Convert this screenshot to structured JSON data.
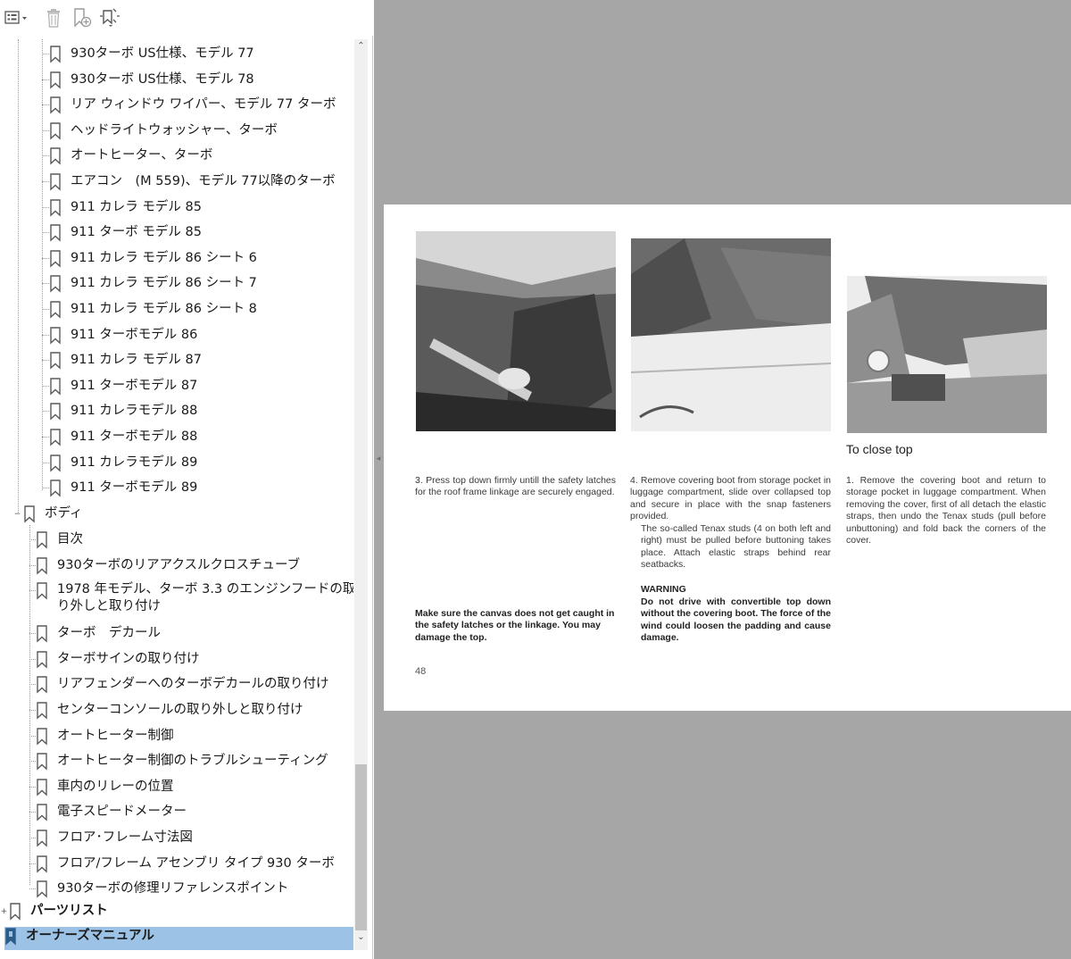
{
  "toolbar": {
    "options_icon": "options-menu-icon",
    "delete_icon": "trash-icon",
    "new_bookmark_icon": "new-bookmark-icon",
    "expand_icon": "expand-bookmark-icon"
  },
  "bookmarks": {
    "turbo_children": [
      "930ターボ US仕様、モデル 77",
      "930ターボ US仕様、モデル 78",
      "リア ウィンドウ ワイパー、モデル 77 ターボ",
      "ヘッドライトウォッシャー、ターボ",
      "オートヒーター、ターボ",
      "エアコン　(M 559)、モデル 77以降のターボ",
      "911 カレラ モデル 85",
      "911 ターボ モデル 85",
      "911 カレラ モデル 86 シート 6",
      "911 カレラ モデル 86 シート 7",
      "911 カレラ モデル 86 シート 8",
      "911 ターボモデル 86",
      "911 カレラ モデル 87",
      "911 ターボモデル 87",
      "911 カレラモデル 88",
      "911 ターボモデル 88",
      "911 カレラモデル 89",
      "911 ターボモデル 89"
    ],
    "body_label": "ボディ",
    "body_children": [
      "目次",
      "930ターボのリアアクスルクロスチューブ",
      "1978 年モデル、ターボ 3.3 のエンジンフードの取り外しと取り付け",
      "ターボ　デカール",
      "ターボサインの取り付け",
      "リアフェンダーへのターボデカールの取り付け",
      "センターコンソールの取り外しと取り付け",
      "オートヒーター制御",
      "オートヒーター制御のトラブルシューティング",
      "車内のリレーの位置",
      "電子スピードメーター",
      "フロア･フレーム寸法図",
      "フロア/フレーム アセンブリ タイプ 930 ターボ",
      "930ターボの修理リファレンスポイント"
    ],
    "parts_label": "パーツリスト",
    "owners_label": "オーナーズマニュアル",
    "expand_symbol": "+",
    "collapse_symbol": "−"
  },
  "document": {
    "section_heading": "To close top",
    "col1_step": "3. Press top down firmly untill the safety latches for the roof frame linkage are securely engaged.",
    "col1_note": "Make sure the canvas does not get caught in the safety latches or the linkage. You may damage the top.",
    "col2_step": "4. Remove covering boot from storage pocket in luggage compartment, slide over collapsed top and secure in place with the snap fasteners provided.",
    "col2_step_cont": "The so-called Tenax studs (4 on both left and right) must be pulled before buttoning takes place. Attach elastic straps behind rear seatbacks.",
    "col2_warning_title": "WARNING",
    "col2_warning": "Do not drive with convertible top down without the covering boot. The force of the wind could loosen the padding and cause damage.",
    "col3_step": "1. Remove the covering boot and return to storage pocket in luggage compartment. When removing the cover, first of all detach the elastic straps, then undo the Tenax studs (pull before unbuttoning) and fold back the corners of the cover.",
    "page_number": "48"
  },
  "colors": {
    "selection": "#9cc3e6",
    "viewer_bg": "#a6a6a6",
    "scroll_thumb": "#c1c1c1"
  }
}
